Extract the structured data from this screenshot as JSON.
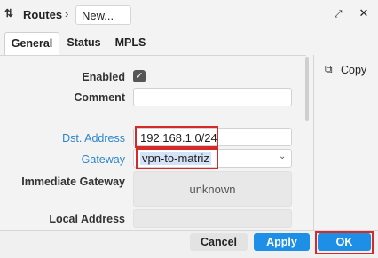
{
  "window": {
    "title": "Routes",
    "breadcrumb_sep": "›",
    "name_field": "New...",
    "expand_icon": "expand-icon",
    "close_icon": "close-icon"
  },
  "tabs": [
    {
      "label": "General",
      "active": true
    },
    {
      "label": "Status",
      "active": false
    },
    {
      "label": "MPLS",
      "active": false
    }
  ],
  "form": {
    "enabled": {
      "label": "Enabled",
      "checked": true
    },
    "comment": {
      "label": "Comment",
      "value": ""
    },
    "dst_address": {
      "label": "Dst. Address",
      "value": "192.168.1.0/24"
    },
    "gateway": {
      "label": "Gateway",
      "value": "vpn-to-matriz"
    },
    "immediate_gateway": {
      "label": "Immediate Gateway",
      "value": "unknown"
    },
    "local_address": {
      "label": "Local Address",
      "value": ""
    }
  },
  "side": {
    "copy_label": "Copy"
  },
  "footer": {
    "cancel": "Cancel",
    "apply": "Apply",
    "ok": "OK"
  },
  "colors": {
    "accent": "#1e8fe6",
    "highlight": "#d62a2a",
    "link_label": "#2b86cc"
  }
}
